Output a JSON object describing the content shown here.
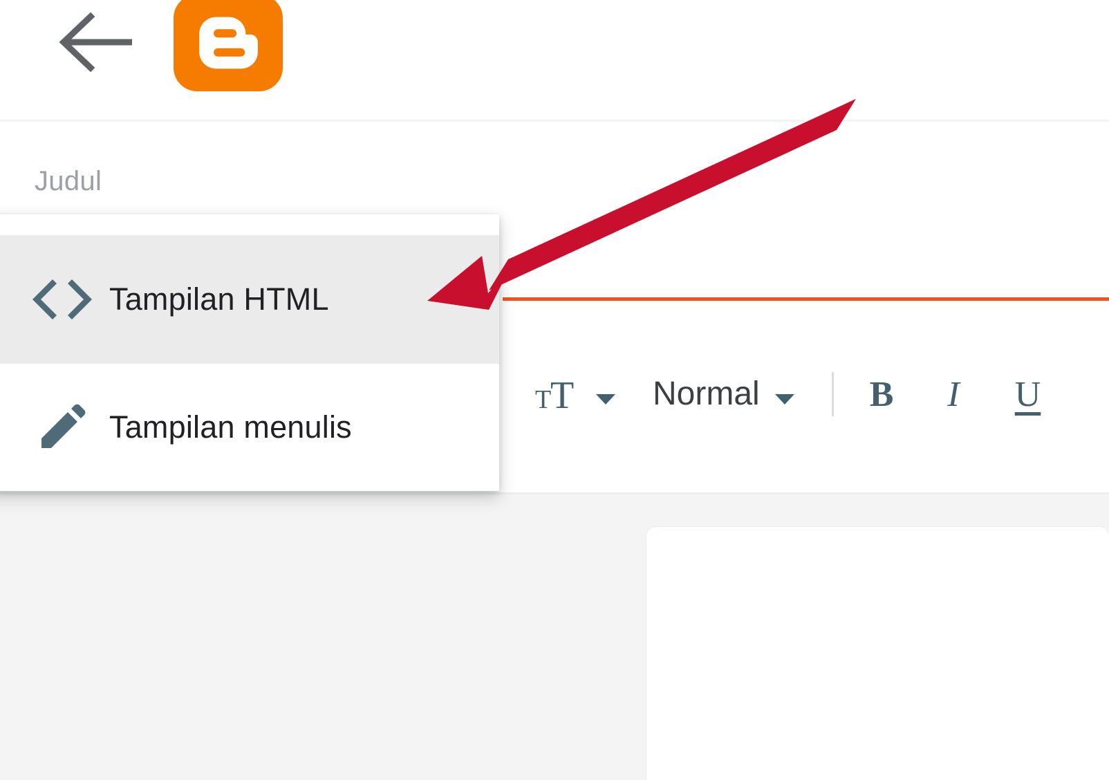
{
  "app": {
    "name": "Blogger",
    "brand_color": "#f57c00",
    "accent_rule_color": "#f4511e",
    "annotation_color": "#c8102e"
  },
  "header": {
    "back_label": "Kembali",
    "back_icon": "arrow-left-icon",
    "logo_icon": "blogger-logo-icon"
  },
  "post": {
    "title_placeholder": "Judul",
    "title_value": "Judul"
  },
  "view_menu": {
    "open": true,
    "items": [
      {
        "label": "Tampilan HTML",
        "icon": "code-brackets-icon",
        "selected": true
      },
      {
        "label": "Tampilan menulis",
        "icon": "pencil-icon",
        "selected": false
      }
    ]
  },
  "toolbar": {
    "font_size_icon": "font-size-icon",
    "font_size_caret_icon": "chevron-down-icon",
    "paragraph_style_label": "Normal",
    "paragraph_style_caret_icon": "chevron-down-icon",
    "bold_label": "B",
    "italic_label": "I",
    "underline_label": "U"
  },
  "annotation": {
    "type": "arrow",
    "points_to": "Tampilan HTML",
    "color": "#c8102e"
  }
}
